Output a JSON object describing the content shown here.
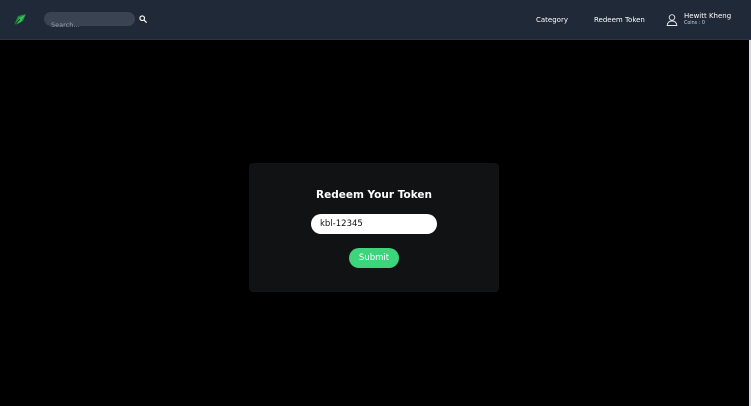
{
  "navbar": {
    "logo_icon": "leaf-logo-icon",
    "search": {
      "placeholder": "Search...",
      "value": "",
      "button_icon": "search-icon"
    },
    "links": [
      {
        "label": "Category"
      },
      {
        "label": "Redeem Token"
      }
    ],
    "user": {
      "icon": "user-icon",
      "name": "Hewitt Kheng",
      "coins": "Coins : 0"
    }
  },
  "redeem_card": {
    "title": "Redeem Your Token",
    "token_value": "kbl-12345",
    "submit_label": "Submit"
  },
  "colors": {
    "navbar_bg": "#202938",
    "page_bg": "#000000",
    "card_bg": "#111213",
    "accent_green": "#3ed47c"
  }
}
